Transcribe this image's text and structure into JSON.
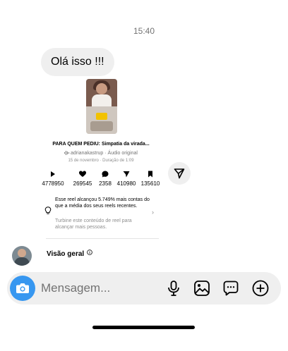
{
  "thread": {
    "timestamp": "15:40",
    "message": "Olá isso !!!"
  },
  "reel": {
    "title": "PARA QUEM PEDIU: Simpatia da virada...",
    "author_line": "adrianakastrup · Áudio original",
    "date_line": "15 de novembro · Duração de 1:09",
    "stats": [
      {
        "icon": "play-icon",
        "value": "4778950"
      },
      {
        "icon": "heart-icon",
        "value": "269545"
      },
      {
        "icon": "comment-icon",
        "value": "2358"
      },
      {
        "icon": "share-icon",
        "value": "410980"
      },
      {
        "icon": "bookmark-icon",
        "value": "135610"
      }
    ],
    "insight_text": "Esse reel alcançou 5.749% mais contas do que a média dos seus reels recentes.",
    "insight_subtext": "Turbine este conteúdo de reel para alcançar mais pessoas."
  },
  "overview": {
    "label": "Visão geral"
  },
  "composer": {
    "placeholder": "Mensagem..."
  },
  "colors": {
    "accent": "#3797f0",
    "bubble": "#efefef",
    "muted_text": "#737373"
  }
}
